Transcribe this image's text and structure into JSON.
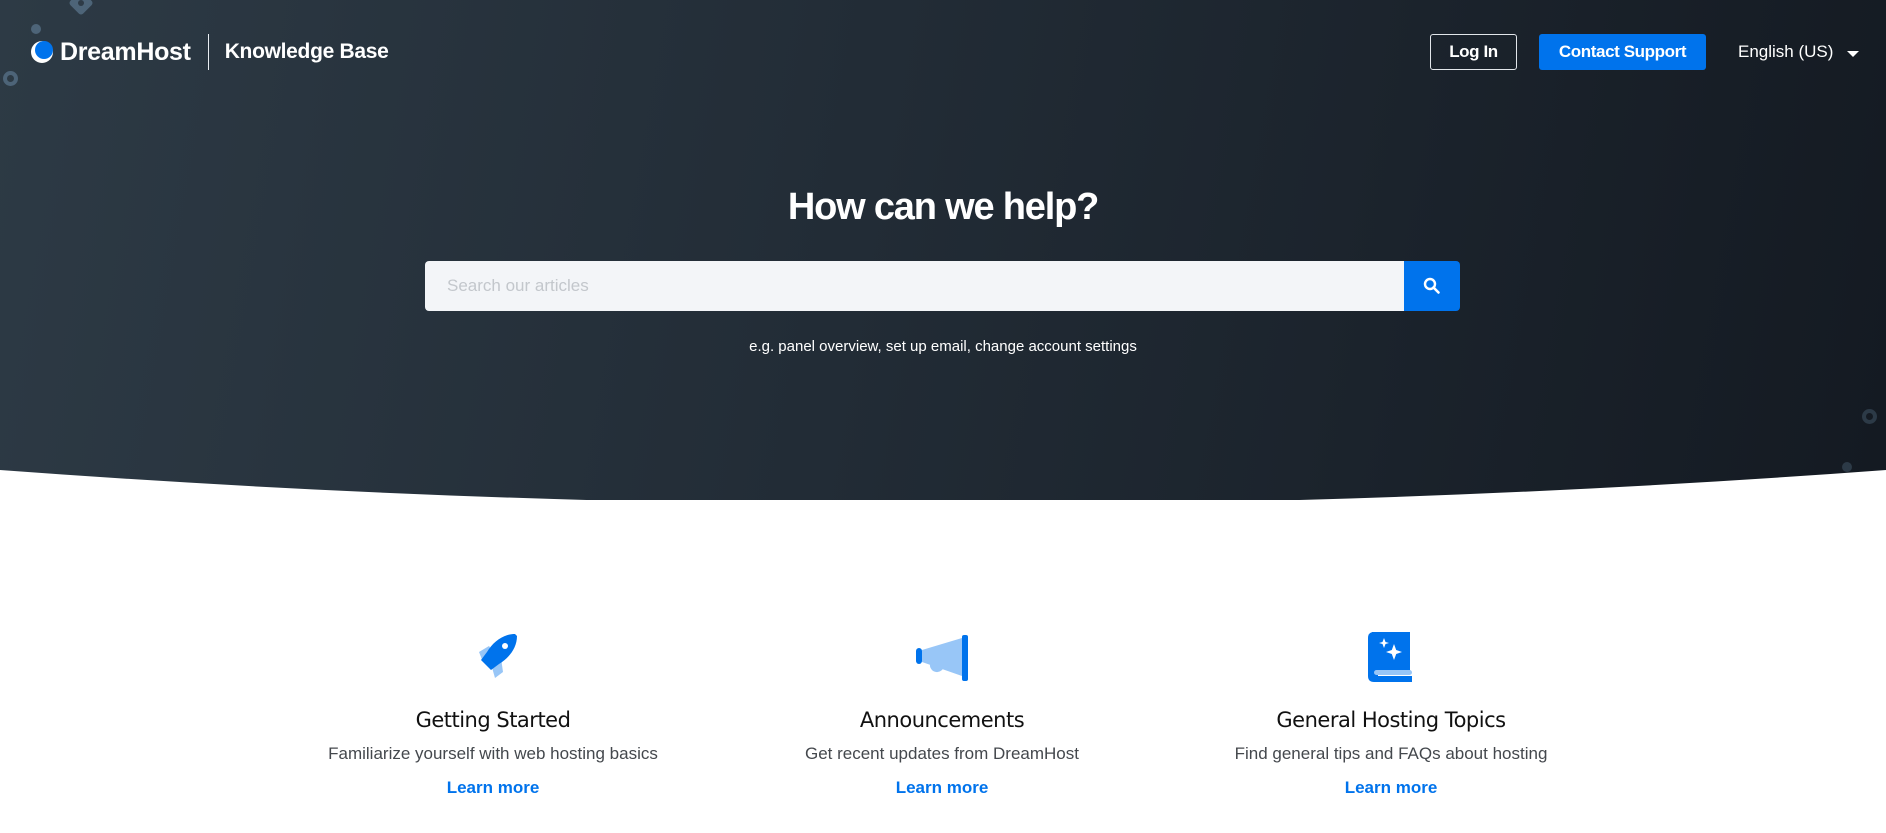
{
  "header": {
    "brand": "DreamHost",
    "section_title": "Knowledge Base",
    "login_label": "Log In",
    "contact_label": "Contact Support",
    "language": "English (US)"
  },
  "hero": {
    "title": "How can we help?",
    "search": {
      "placeholder": "Search our articles",
      "value": ""
    },
    "examples": "e.g.  panel overview, set up email, change account settings"
  },
  "cards": [
    {
      "icon": "rocket-icon",
      "title": "Getting Started",
      "description": "Familiarize yourself with web hosting basics",
      "link": "Learn more"
    },
    {
      "icon": "megaphone-icon",
      "title": "Announcements",
      "description": "Get recent updates from DreamHost",
      "link": "Learn more"
    },
    {
      "icon": "book-sparkle-icon",
      "title": "General Hosting Topics",
      "description": "Find general tips and FAQs about hosting",
      "link": "Learn more"
    }
  ],
  "colors": {
    "accent": "#0073ec",
    "accent_light": "#98c6f7",
    "hero_dark": "#141a22",
    "hero_light": "#2d3a45"
  }
}
